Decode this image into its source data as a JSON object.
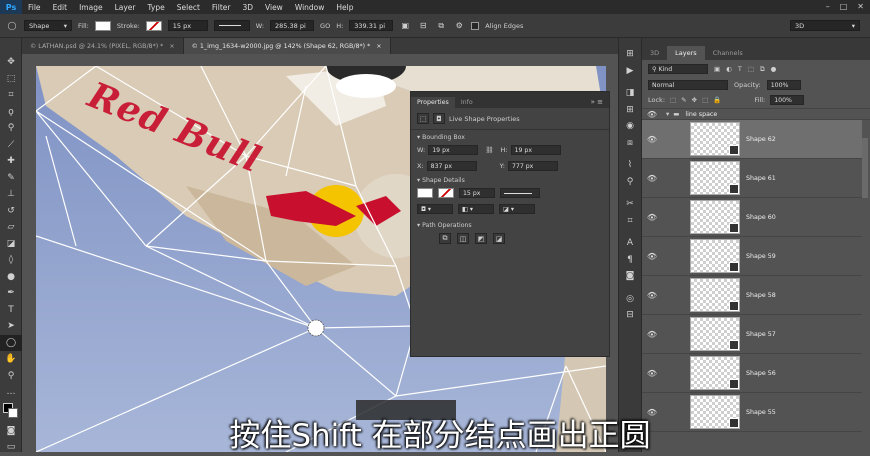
{
  "app": {
    "logo": "Ps"
  },
  "menu": [
    "File",
    "Edit",
    "Image",
    "Layer",
    "Type",
    "Select",
    "Filter",
    "3D",
    "View",
    "Window",
    "Help"
  ],
  "options": {
    "mode": "Shape",
    "fill_label": "Fill:",
    "stroke_label": "Stroke:",
    "stroke_size": "15 px",
    "w_label": "W:",
    "w_value": "285.38 pi",
    "go_label": "GO",
    "h_label": "H:",
    "h_value": "339.31 pi",
    "align_edges": "Align Edges",
    "workspace": "3D"
  },
  "tabs": [
    "© LATHAN.psd @ 24.1% (PIXEL, RGB/8*) *",
    "© 1_img_1634-w2000.jpg @ 142% (Shape 62, RGB/8*) *"
  ],
  "properties": {
    "tab_active": "Properties",
    "tab_other": "Info",
    "title": "Live Shape Properties",
    "bounding_box": "Bounding Box",
    "w_label": "W:",
    "w": "19 px",
    "h_label": "H:",
    "h": "19 px",
    "x_label": "X:",
    "x": "837 px",
    "y_label": "Y:",
    "y": "777 px",
    "shape_details": "Shape Details",
    "stroke_size": "15 px",
    "path_operations": "Path Operations"
  },
  "layers": {
    "tab_3d": "3D",
    "tab_layers": "Layers",
    "tab_channels": "Channels",
    "kind": "Kind",
    "blend": "Normal",
    "opacity_label": "Opacity:",
    "opacity": "100%",
    "lock_label": "Lock:",
    "fill_label": "Fill:",
    "fill": "100%",
    "group_name": "line space",
    "items": [
      "Shape 62",
      "Shape 61",
      "Shape 60",
      "Shape 59",
      "Shape 58",
      "Shape 57",
      "Shape 56",
      "Shape 55"
    ]
  },
  "canvas": {
    "brand_text": "Red Bull"
  },
  "subtitle": "按住Shift 在部分结点画出正圆",
  "colors": {
    "accent": "#31a8ff",
    "brand_red": "#c8102e",
    "brand_yellow": "#f5c400",
    "sky": "#8fa3cf"
  }
}
